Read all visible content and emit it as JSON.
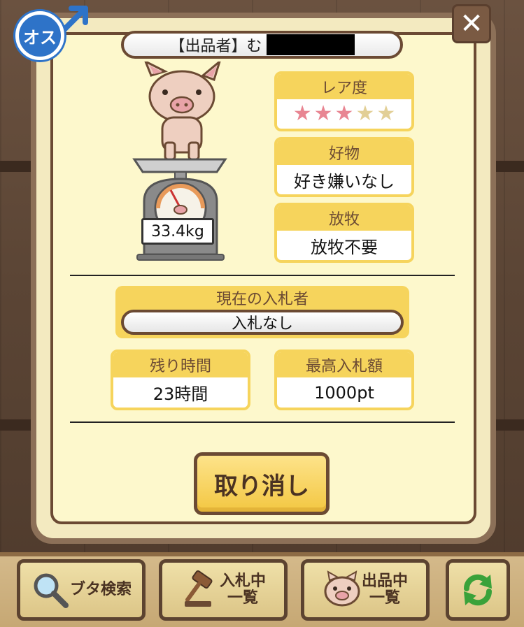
{
  "gender": {
    "label": "オス",
    "icon": "male-symbol-icon",
    "color": "#2e73c8"
  },
  "close": {
    "label": "✕",
    "icon": "close-icon"
  },
  "seller": {
    "label": "【出品者】む"
  },
  "pig": {
    "weight": "33.4kg",
    "icon": "pig-on-scale-icon"
  },
  "rarity": {
    "title": "レア度",
    "stars_filled": 3,
    "stars_total": 5
  },
  "favorite": {
    "title": "好物",
    "value": "好き嫌いなし"
  },
  "grazing": {
    "title": "放牧",
    "value": "放牧不要"
  },
  "bidder": {
    "title": "現在の入札者",
    "value": "入札なし"
  },
  "remaining": {
    "title": "残り時間",
    "value": "23時間"
  },
  "highest_bid": {
    "title": "最高入札額",
    "value": "1000pt"
  },
  "cancel_button": {
    "label": "取り消し"
  },
  "toolbar": {
    "search": {
      "label": "ブタ検索",
      "icon": "magnifier-icon"
    },
    "bidding": {
      "label_line1": "入札中",
      "label_line2": "一覧",
      "icon": "gavel-icon"
    },
    "listing": {
      "label_line1": "出品中",
      "label_line2": "一覧",
      "icon": "pig-face-icon"
    },
    "refresh": {
      "icon": "refresh-icon",
      "color": "#3aa23a"
    }
  },
  "colors": {
    "card_yellow": "#f6d45c",
    "frame_brown": "#6b4a33",
    "panel_cream": "#fdf8cc",
    "star_filled": "#e88592",
    "star_empty": "#e2cf96"
  }
}
